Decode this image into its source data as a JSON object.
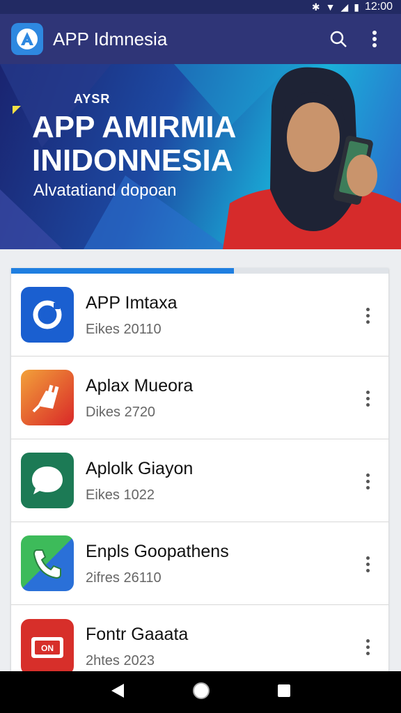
{
  "status_bar": {
    "time": "12:00",
    "icons": [
      "bluetooth-icon",
      "wifi-icon",
      "signal-icon",
      "battery-icon"
    ]
  },
  "app_bar": {
    "title": "APP Idmnesia",
    "actions": [
      "search-icon",
      "more-vert-icon"
    ]
  },
  "banner": {
    "kicker": "AYSR",
    "line1": "APP AMIRMIA",
    "line2": "INIDONNESIA",
    "subtitle": "Alvatatiand dopoan"
  },
  "list": {
    "progress": 0.59,
    "items": [
      {
        "title": "APP Imtaxa",
        "subtitle": "Eikes 20110",
        "icon": "camera-ring-icon",
        "color": "#1a5fd0"
      },
      {
        "title": "Aplax Mueora",
        "subtitle": "Dikes 2720",
        "icon": "plug-icon",
        "color": "#e0392a"
      },
      {
        "title": "Aplolk Giayon",
        "subtitle": "Eikes 1022",
        "icon": "chat-bubble-icon",
        "color": "#1c7a55"
      },
      {
        "title": "Enpls Goopathens",
        "subtitle": "2ifres 26110",
        "icon": "phone-icon",
        "color": "#3aaa5c"
      },
      {
        "title": "Fontr Gaaata",
        "subtitle": "2htes 2023",
        "icon": "ticket-icon",
        "color": "#d72f2a"
      }
    ]
  },
  "nav_bar": {
    "buttons": [
      "back-icon",
      "home-icon",
      "recents-icon"
    ]
  }
}
